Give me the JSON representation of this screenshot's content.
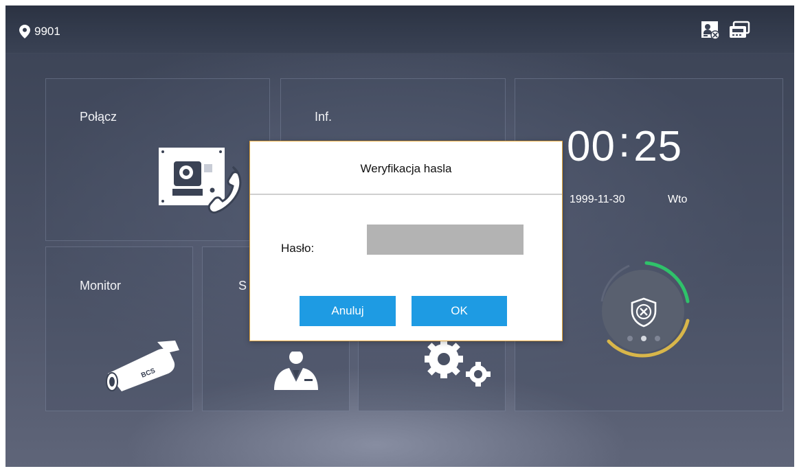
{
  "status_bar": {
    "location_icon": "location-pin-icon",
    "device_number": "9901",
    "icons": [
      "card-reader-disconnected-icon",
      "network-device-icon"
    ]
  },
  "tiles": {
    "connect": {
      "label": "Połącz",
      "icon": "door-station-call-icon"
    },
    "info": {
      "label": "Inf."
    },
    "monitor": {
      "label": "Monitor",
      "icon": "bcs-camera-icon",
      "icon_text": "BCS"
    },
    "service": {
      "label": "S",
      "icon": "agent-icon"
    },
    "settings": {
      "icon": "gears-icon"
    },
    "clock": {
      "time_hh": "00",
      "time_sep": ":",
      "time_mm": "25",
      "date": "1999-11-30",
      "day": "Wto",
      "arm_icon": "shield-x-icon",
      "page_dots": 3,
      "active_dot": 2
    }
  },
  "dialog": {
    "title": "Weryfikacja hasla",
    "password_label": "Hasło:",
    "password_value": "",
    "cancel_label": "Anuluj",
    "ok_label": "OK"
  },
  "colors": {
    "button_blue": "#1e9be3",
    "dialog_border": "#e6a63a",
    "arc_green": "#2fc26a",
    "arc_yellow": "#d8b64a",
    "input_gray": "#b3b3b3"
  }
}
